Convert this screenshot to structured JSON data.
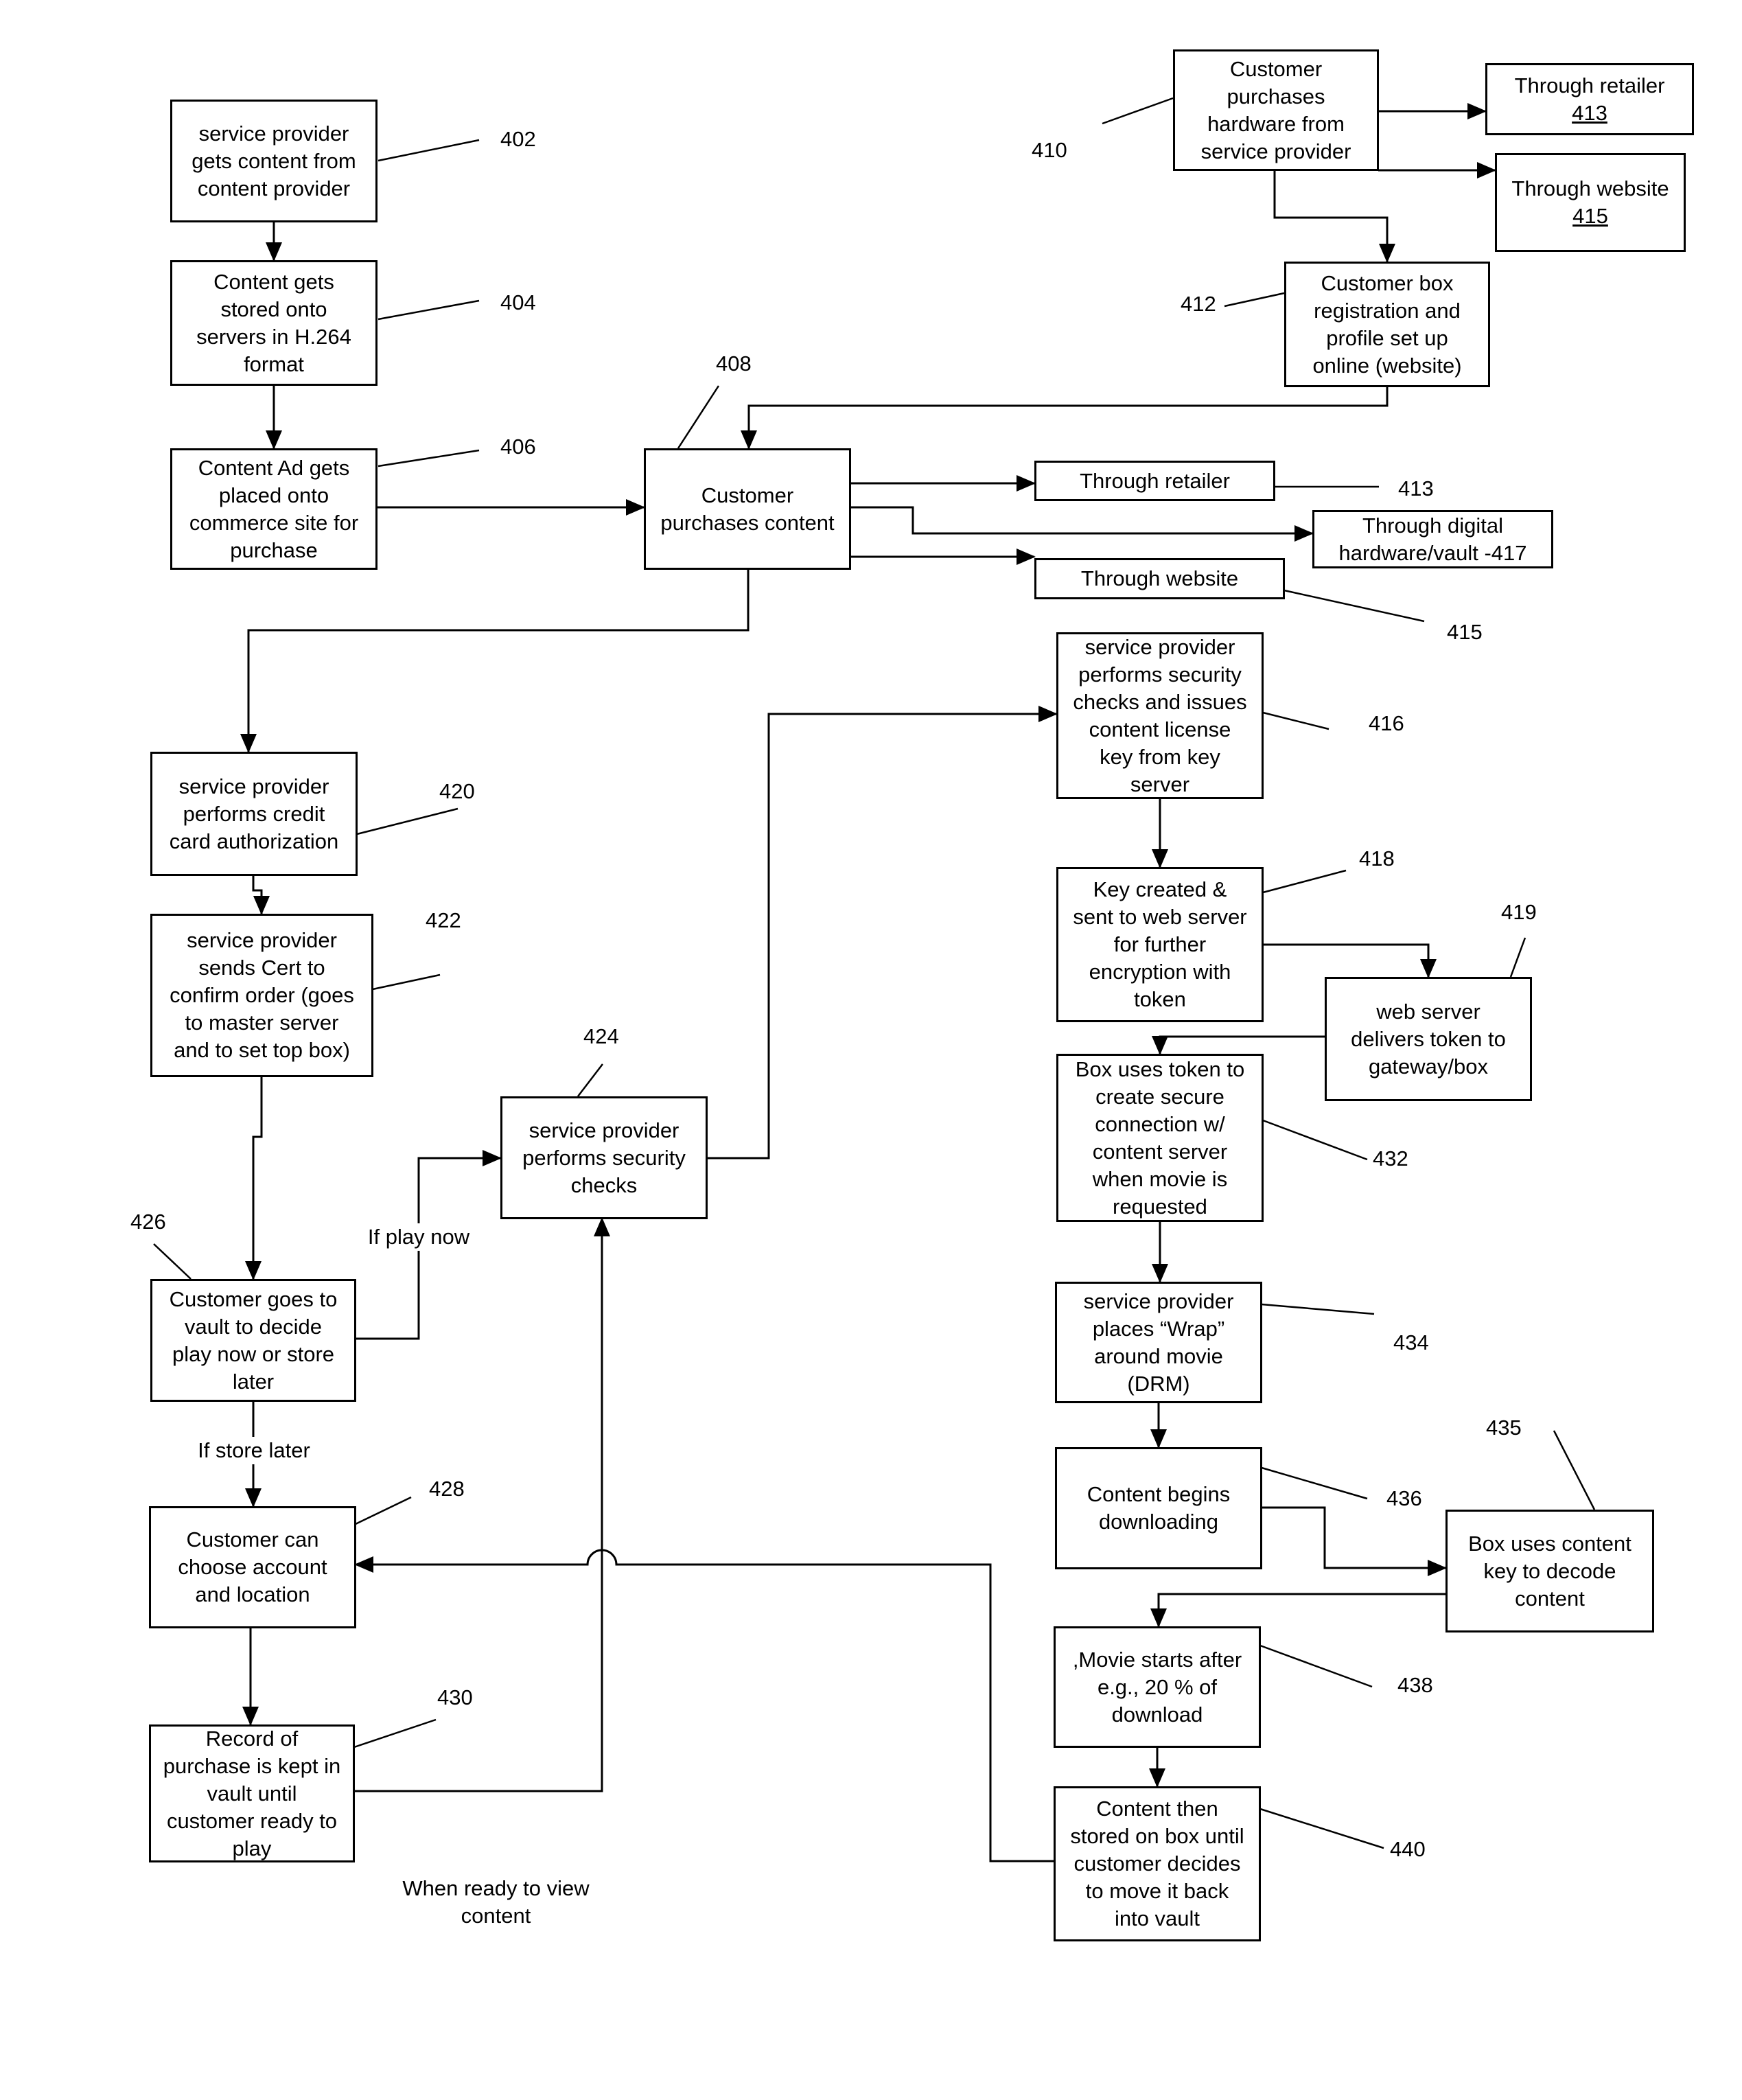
{
  "diagram": {
    "type": "flowchart",
    "nodes": {
      "n402": {
        "ref": "402",
        "text": "service provider\ngets content from\ncontent provider"
      },
      "n404": {
        "ref": "404",
        "text": "Content gets\nstored onto\nservers in H.264\nformat"
      },
      "n406": {
        "ref": "406",
        "text": "Content Ad gets\nplaced onto\ncommerce site for\npurchase"
      },
      "n408": {
        "ref": "408",
        "text": "Customer\npurchases content"
      },
      "n410": {
        "ref": "410",
        "text": "Customer\npurchases\nhardware from\nservice provider"
      },
      "n413_hw": {
        "ref": "413",
        "text": "Through retailer"
      },
      "n415_hw": {
        "ref": "415",
        "text": "Through website"
      },
      "n412": {
        "ref": "412",
        "text": "Customer box\nregistration and\nprofile set up\nonline (website)"
      },
      "n413_content": {
        "ref": "413",
        "text": "Through retailer"
      },
      "n417": {
        "ref": "417",
        "text": "Through digital\nhardware/vault -417"
      },
      "n415_content": {
        "ref": "415",
        "text": "Through website"
      },
      "n416": {
        "ref": "416",
        "text": "service provider\nperforms security\nchecks and issues\ncontent license\nkey from key\nserver"
      },
      "n418": {
        "ref": "418",
        "text": "Key created &\nsent to web server\nfor further\nencryption with\ntoken"
      },
      "n419": {
        "ref": "419",
        "text": "web server\ndelivers token to\ngateway/box"
      },
      "n432": {
        "ref": "432",
        "text": "Box uses token to\ncreate secure\nconnection w/\ncontent server\nwhen movie is\nrequested"
      },
      "n434": {
        "ref": "434",
        "text": "service provider\nplaces “Wrap”\naround movie\n(DRM)"
      },
      "n436": {
        "ref": "436",
        "text": "Content begins\ndownloading"
      },
      "n435": {
        "ref": "435",
        "text": "Box uses content\nkey to decode\ncontent"
      },
      "n438": {
        "ref": "438",
        "text": ",Movie starts after\ne.g., 20 % of\ndownload"
      },
      "n440": {
        "ref": "440",
        "text": "Content then\nstored on box until\ncustomer decides\nto move it back\ninto vault"
      },
      "n420": {
        "ref": "420",
        "text": "service provider\nperforms credit\ncard authorization"
      },
      "n422": {
        "ref": "422",
        "text": "service provider\nsends Cert to\nconfirm order (goes\nto master server\nand to set top box)"
      },
      "n424": {
        "ref": "424",
        "text": "service provider\nperforms security\nchecks"
      },
      "n426": {
        "ref": "426",
        "text": "Customer goes to\nvault to decide\nplay now or store\nlater"
      },
      "n428": {
        "ref": "428",
        "text": "Customer can\nchoose account\nand location"
      },
      "n430": {
        "ref": "430",
        "text": "Record of\npurchase is kept in\nvault until\ncustomer ready to\nplay"
      }
    },
    "edge_labels": {
      "play_now": "If play now",
      "store_later": "If store later",
      "ready_to_view": "When ready to view\ncontent"
    },
    "edges": [
      [
        "402",
        "404"
      ],
      [
        "404",
        "406"
      ],
      [
        "406",
        "408"
      ],
      [
        "410",
        "413 (Through retailer)"
      ],
      [
        "410",
        "415 (Through website)"
      ],
      [
        "410",
        "412"
      ],
      [
        "412",
        "408"
      ],
      [
        "408",
        "413 (Through retailer)"
      ],
      [
        "408",
        "417"
      ],
      [
        "408",
        "415 (Through website)"
      ],
      [
        "408",
        "420"
      ],
      [
        "420",
        "422"
      ],
      [
        "422",
        "426"
      ],
      [
        "426",
        "424",
        "If play now"
      ],
      [
        "426",
        "428",
        "If store later"
      ],
      [
        "424",
        "416"
      ],
      [
        "416",
        "418"
      ],
      [
        "418",
        "419"
      ],
      [
        "419",
        "432"
      ],
      [
        "432",
        "434"
      ],
      [
        "434",
        "436"
      ],
      [
        "436",
        "435"
      ],
      [
        "435",
        "438"
      ],
      [
        "438",
        "440"
      ],
      [
        "440",
        "428"
      ],
      [
        "428",
        "430"
      ],
      [
        "430",
        "424",
        "When ready to view content"
      ]
    ]
  }
}
